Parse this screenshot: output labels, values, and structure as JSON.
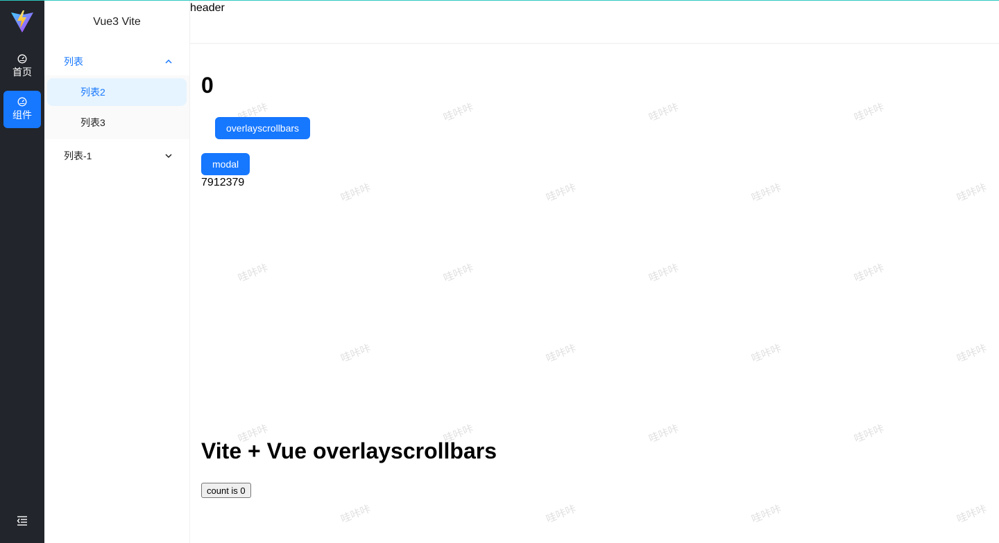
{
  "app": {
    "brand_title": "Vue3 Vite",
    "header_text": "header"
  },
  "rail": {
    "items": [
      {
        "label": "首页",
        "icon": "dashboard-icon",
        "active": false
      },
      {
        "label": "组件",
        "icon": "dashboard-icon",
        "active": true
      }
    ],
    "collapse_icon": "menu-fold-icon"
  },
  "submenu": {
    "group1": {
      "label": "列表",
      "expanded": true
    },
    "group1_items": [
      {
        "label": "列表2",
        "active": true
      },
      {
        "label": "列表3",
        "active": false
      }
    ],
    "group2": {
      "label": "列表-1",
      "expanded": false
    }
  },
  "content": {
    "counter": "0",
    "overlay_button": "overlayscrollbars",
    "modal_button": "modal",
    "number_text": "7912379",
    "title": "Vite + Vue overlayscrollbars",
    "count_button": "count is 0"
  },
  "watermark": {
    "text": "哇咔咔"
  },
  "colors": {
    "rail_bg": "#22252b",
    "primary": "#1677ff",
    "active_bg": "#e6f4ff",
    "top_border": "#2ec7c0"
  }
}
